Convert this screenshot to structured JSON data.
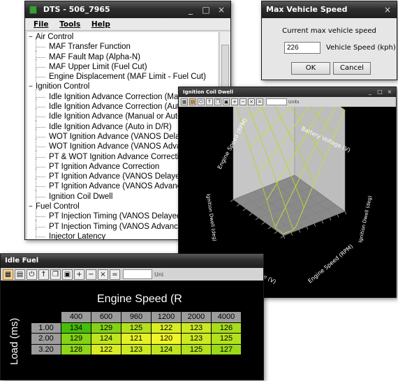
{
  "dts_window": {
    "title": "DTS - 506_7965",
    "menu": [
      "File",
      "Tools",
      "Help"
    ],
    "tree": [
      {
        "label": "Air Control",
        "children": [
          "MAF Transfer Function",
          "MAF Fault Map (Alpha-N)",
          "MAF Upper Limit (Fuel Cut)",
          "Engine Displacement (MAF Limit - Fuel Cut)"
        ]
      },
      {
        "label": "Ignition Control",
        "children": [
          "Idle Ignition Advance Correction (Manual or A",
          "Idle Ignition Advance Correction (Auto in D/R",
          "Idle Ignition Advance (Manual or Auto in P/N",
          "Idle Ignition Advance (Auto in D/R)",
          "WOT Ignition Advance (VANOS Delayed)",
          "WOT Ignition Advance (VANOS Advanced)",
          "PT & WOT Ignition Advance Correction",
          "PT Ignition Advance Correction",
          "PT Ignition Advance (VANOS Delayed)",
          "PT Ignition Advance (VANOS Advanced)",
          "Ignition Coil Dwell"
        ]
      },
      {
        "label": "Fuel Control",
        "children": [
          "PT Injection Timing (VANOS Delayed)",
          "PT Injection Timing (VANOS Advanced)",
          "Injector Latency"
        ]
      }
    ]
  },
  "max_speed_dialog": {
    "title": "Max Vehicle Speed",
    "message": "Current max vehicle speed",
    "value": "226",
    "unit_label": "Vehicle Speed (kph)",
    "ok_label": "OK",
    "cancel_label": "Cancel"
  },
  "coil_window": {
    "title": "Ignition Coil Dwell",
    "units_label": "Units",
    "axis_labels": {
      "engine_speed_back": "Engine Speed (RPM)",
      "battery_back": "Battery Voltage (V)",
      "dwell_left": "Ignition Dwell (deg)",
      "dwell_right": "Ignition Dwell (deg)",
      "battery_front": "Battery Voltage (V)",
      "engine_speed_front": "Engine Speed (RPM)"
    }
  },
  "idle_window": {
    "title": "Idle Fuel",
    "units_label": "Uni",
    "x_title": "Engine Speed (R",
    "y_title": "Load (ms)",
    "columns": [
      "400",
      "600",
      "960",
      "1200",
      "2000",
      "4000"
    ],
    "rows": [
      {
        "label": "1.00",
        "values": [
          "134",
          "129",
          "125",
          "122",
          "123",
          "126"
        ]
      },
      {
        "label": "2.00",
        "values": [
          "129",
          "124",
          "121",
          "120",
          "123",
          "125"
        ]
      },
      {
        "label": "3.20",
        "values": [
          "128",
          "122",
          "123",
          "124",
          "125",
          "127"
        ]
      }
    ]
  },
  "icons": {
    "close": "×",
    "minimize": "_",
    "maximize": "□"
  }
}
